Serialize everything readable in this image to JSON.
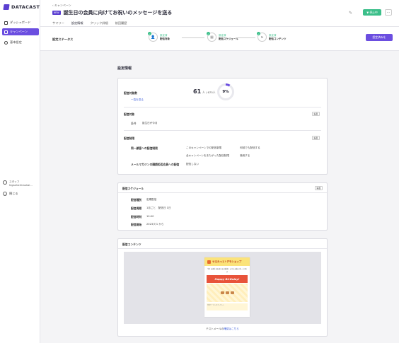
{
  "sidebar": {
    "logo_text": "DATACAST",
    "items": [
      {
        "label": "ダッシュボード",
        "icon": "dashboard-icon"
      },
      {
        "label": "キャンペーン",
        "icon": "send-icon"
      },
      {
        "label": "基本設定",
        "icon": "gear-icon"
      }
    ],
    "user": {
      "role": "スタッフ",
      "name": "higashichiraukai..."
    },
    "back_label": "閉じる"
  },
  "header": {
    "breadcrumb": "キャンペーン",
    "badge": "NEW",
    "title": "誕生日の会員に向けてお祝いのメッセージを送る",
    "status_button": "▼ 停止中",
    "more_button": "⋯",
    "tabs": [
      "サマリー",
      "設定情報",
      "クリック詳細",
      "前回履歴"
    ],
    "active_tab": 1
  },
  "status": {
    "label": "設定ステータス",
    "steps": [
      {
        "status": "設定済",
        "name": "配信対象"
      },
      {
        "status": "設定済",
        "name": "配信スケジュール"
      },
      {
        "status": "設定済",
        "name": "配信コンテンツ"
      }
    ],
    "done_button": "設定済みを"
  },
  "settings": {
    "section_title": "設定情報",
    "target_count_label": "配信対象数",
    "count_value": "61",
    "count_unit": "人 / 675人",
    "percent": "9%",
    "percent_value": 9,
    "list_link": "一覧を見る",
    "target": {
      "heading": "配信対象",
      "edit": "編集",
      "condition_label": "条件",
      "condition_value": "誕生日が今月"
    },
    "limits": {
      "heading": "配信制限",
      "edit": "編集",
      "rows": [
        {
          "label": "同一顧客への配信制限",
          "col1": "このキャンペーンでの配信制限",
          "col2": "何回でも配信する"
        },
        {
          "label": "",
          "col1": "全キャンペーンをまたがった配信制限",
          "col2": "適用する"
        },
        {
          "label": "メールマガジンの購読拒否会員への配信",
          "col1": "配信しない",
          "col2": ""
        }
      ]
    }
  },
  "schedule": {
    "heading": "配信スケジュール",
    "edit": "編集",
    "rows": [
      {
        "label": "配信種別",
        "value": "定期配信"
      },
      {
        "label": "配信周期",
        "value": "1月ごと　配信日 1日"
      },
      {
        "label": "配信時刻",
        "value": "10:00"
      },
      {
        "label": "配信開始",
        "value": "2023/7/1 から"
      }
    ]
  },
  "content": {
    "heading": "配信コンテンツ",
    "mail_shop": "せるみっと! デモショップ",
    "mail_intro": "今月 お誕生日を迎えるお客様へ 心からお祝い申し上げます",
    "mail_banner": "Happy Birthday!",
    "mail_foot": "特別クーポンをプレゼント",
    "test_prefix": "テストメールの",
    "test_link": "確認はこちら"
  }
}
